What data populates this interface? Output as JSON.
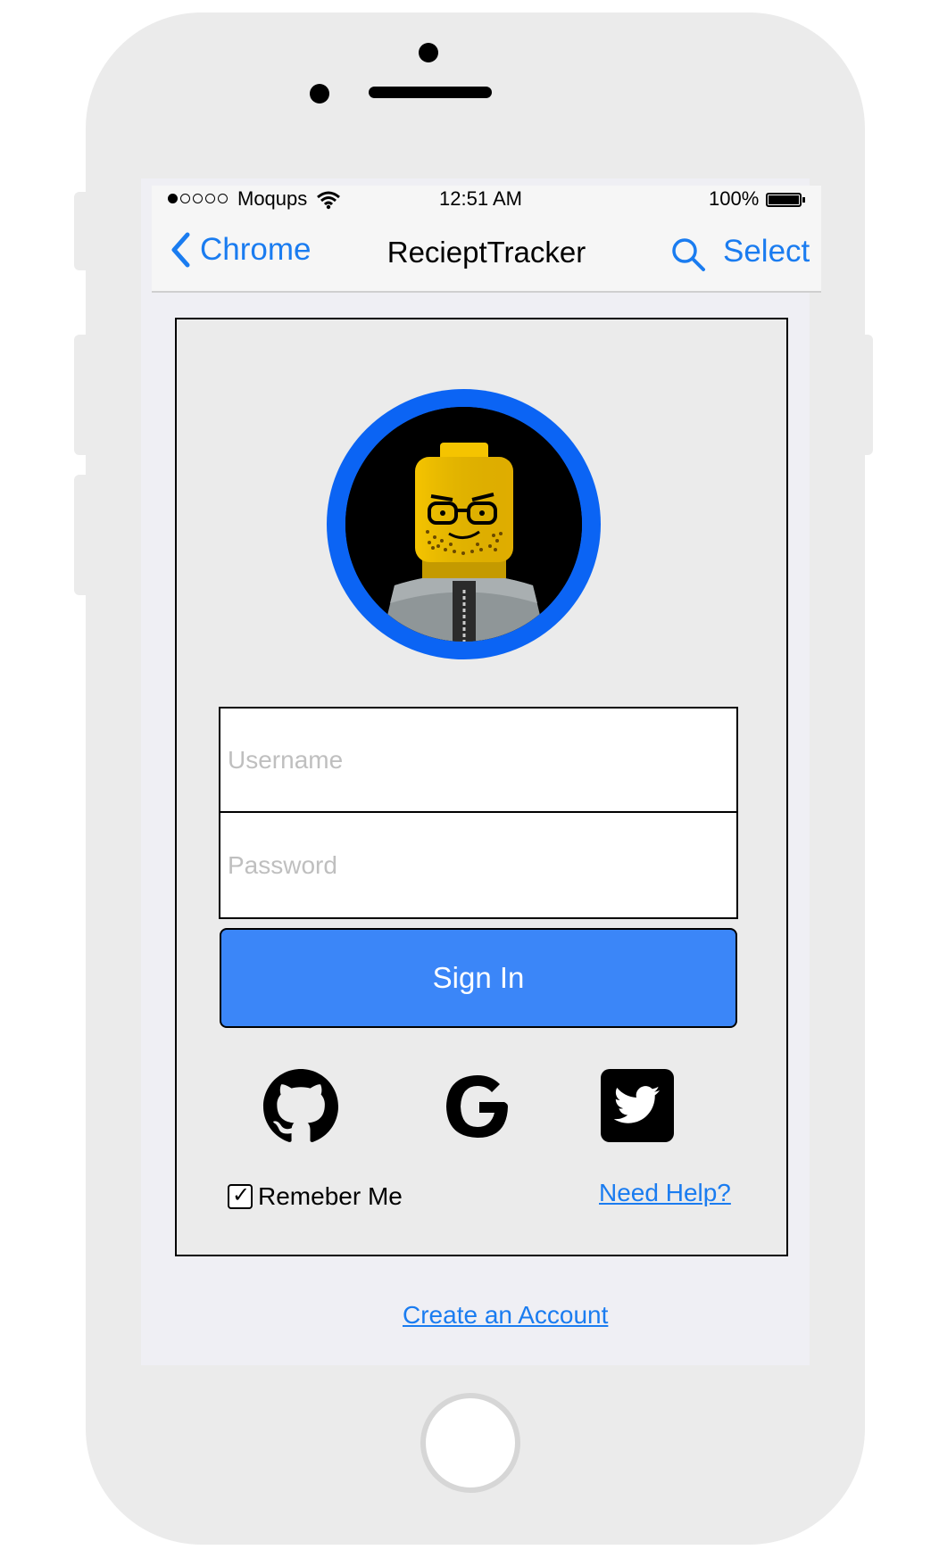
{
  "status_bar": {
    "carrier": "Moqups",
    "time": "12:51 AM",
    "battery": "100%"
  },
  "nav_bar": {
    "back_label": "Chrome",
    "title": "RecieptTracker",
    "select_label": "Select"
  },
  "login": {
    "username_placeholder": "Username",
    "password_placeholder": "Password",
    "signin_label": "Sign In",
    "remember_label": "Remeber Me",
    "remember_checked": true,
    "help_link": "Need Help?",
    "create_account_link": "Create an Account"
  },
  "colors": {
    "accent": "#1a7cf0",
    "signin_button": "#3b86f8",
    "avatar_ring": "#0b64f4"
  },
  "icons": [
    "chevron-left-icon",
    "search-icon",
    "wifi-icon",
    "battery-icon",
    "github-icon",
    "google-icon",
    "twitter-icon",
    "checkbox-icon"
  ]
}
